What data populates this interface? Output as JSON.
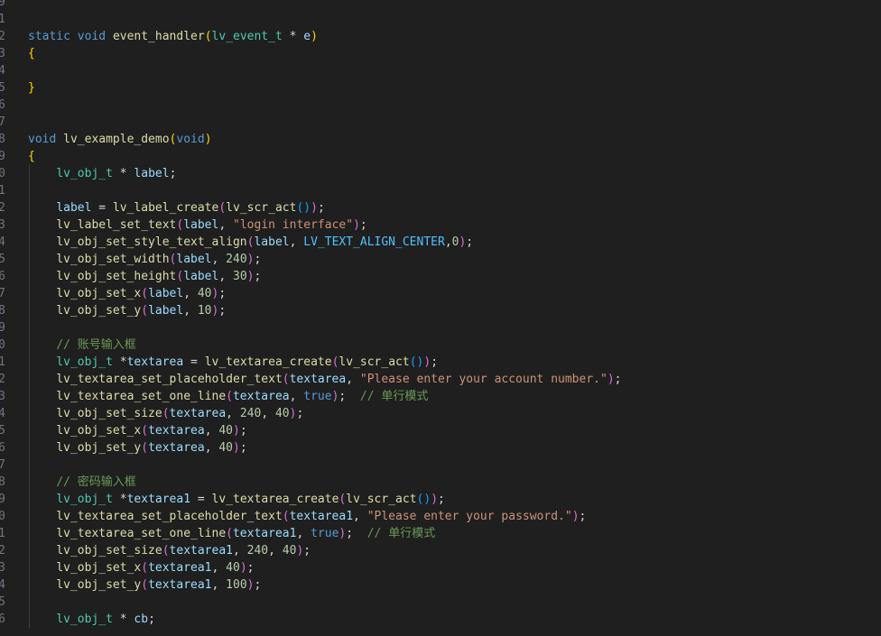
{
  "editor": {
    "lines": [
      {
        "n": "9",
        "t": []
      },
      {
        "n": "1",
        "t": []
      },
      {
        "n": "2",
        "t": [
          [
            "kw",
            "static"
          ],
          [
            "op",
            " "
          ],
          [
            "kw",
            "void"
          ],
          [
            "op",
            " "
          ],
          [
            "fn",
            "event_handler"
          ],
          [
            "p1",
            "("
          ],
          [
            "ty",
            "lv_event_t"
          ],
          [
            "op",
            " * "
          ],
          [
            "var",
            "e"
          ],
          [
            "p1",
            ")"
          ]
        ]
      },
      {
        "n": "3",
        "t": [
          [
            "p1",
            "{"
          ]
        ]
      },
      {
        "n": "4",
        "t": []
      },
      {
        "n": "5",
        "t": [
          [
            "p1",
            "}"
          ]
        ]
      },
      {
        "n": "6",
        "t": []
      },
      {
        "n": "7",
        "t": []
      },
      {
        "n": "8",
        "t": [
          [
            "kw",
            "void"
          ],
          [
            "op",
            " "
          ],
          [
            "fn",
            "lv_example_demo"
          ],
          [
            "p1",
            "("
          ],
          [
            "kw",
            "void"
          ],
          [
            "p1",
            ")"
          ]
        ]
      },
      {
        "n": "9",
        "t": [
          [
            "p1",
            "{"
          ]
        ]
      },
      {
        "n": "0",
        "t": [
          [
            "op",
            "    "
          ],
          [
            "ty",
            "lv_obj_t"
          ],
          [
            "op",
            " * "
          ],
          [
            "var",
            "label"
          ],
          [
            "op",
            ";"
          ]
        ]
      },
      {
        "n": "1",
        "t": []
      },
      {
        "n": "2",
        "t": [
          [
            "op",
            "    "
          ],
          [
            "var",
            "label"
          ],
          [
            "op",
            " = "
          ],
          [
            "fn",
            "lv_label_create"
          ],
          [
            "p2",
            "("
          ],
          [
            "fn",
            "lv_scr_act"
          ],
          [
            "p3",
            "()"
          ],
          [
            "p2",
            ")"
          ],
          [
            "op",
            ";"
          ]
        ]
      },
      {
        "n": "3",
        "t": [
          [
            "op",
            "    "
          ],
          [
            "fn",
            "lv_label_set_text"
          ],
          [
            "p2",
            "("
          ],
          [
            "var",
            "label"
          ],
          [
            "op",
            ", "
          ],
          [
            "str",
            "\"login interface\""
          ],
          [
            "p2",
            ")"
          ],
          [
            "op",
            ";"
          ]
        ]
      },
      {
        "n": "4",
        "t": [
          [
            "op",
            "    "
          ],
          [
            "fn",
            "lv_obj_set_style_text_align"
          ],
          [
            "p2",
            "("
          ],
          [
            "var",
            "label"
          ],
          [
            "op",
            ", "
          ],
          [
            "mac",
            "LV_TEXT_ALIGN_CENTER"
          ],
          [
            "op",
            ","
          ],
          [
            "num",
            "0"
          ],
          [
            "p2",
            ")"
          ],
          [
            "op",
            ";"
          ]
        ]
      },
      {
        "n": "5",
        "t": [
          [
            "op",
            "    "
          ],
          [
            "fn",
            "lv_obj_set_width"
          ],
          [
            "p2",
            "("
          ],
          [
            "var",
            "label"
          ],
          [
            "op",
            ", "
          ],
          [
            "num",
            "240"
          ],
          [
            "p2",
            ")"
          ],
          [
            "op",
            ";"
          ]
        ]
      },
      {
        "n": "6",
        "t": [
          [
            "op",
            "    "
          ],
          [
            "fn",
            "lv_obj_set_height"
          ],
          [
            "p2",
            "("
          ],
          [
            "var",
            "label"
          ],
          [
            "op",
            ", "
          ],
          [
            "num",
            "30"
          ],
          [
            "p2",
            ")"
          ],
          [
            "op",
            ";"
          ]
        ]
      },
      {
        "n": "7",
        "t": [
          [
            "op",
            "    "
          ],
          [
            "fn",
            "lv_obj_set_x"
          ],
          [
            "p2",
            "("
          ],
          [
            "var",
            "label"
          ],
          [
            "op",
            ", "
          ],
          [
            "num",
            "40"
          ],
          [
            "p2",
            ")"
          ],
          [
            "op",
            ";"
          ]
        ]
      },
      {
        "n": "8",
        "t": [
          [
            "op",
            "    "
          ],
          [
            "fn",
            "lv_obj_set_y"
          ],
          [
            "p2",
            "("
          ],
          [
            "var",
            "label"
          ],
          [
            "op",
            ", "
          ],
          [
            "num",
            "10"
          ],
          [
            "p2",
            ")"
          ],
          [
            "op",
            ";"
          ]
        ]
      },
      {
        "n": "9",
        "t": []
      },
      {
        "n": "0",
        "t": [
          [
            "op",
            "    "
          ],
          [
            "cmt",
            "// 账号输入框"
          ]
        ]
      },
      {
        "n": "1",
        "t": [
          [
            "op",
            "    "
          ],
          [
            "ty",
            "lv_obj_t"
          ],
          [
            "op",
            " *"
          ],
          [
            "var",
            "textarea"
          ],
          [
            "op",
            " = "
          ],
          [
            "fn",
            "lv_textarea_create"
          ],
          [
            "p2",
            "("
          ],
          [
            "fn",
            "lv_scr_act"
          ],
          [
            "p3",
            "()"
          ],
          [
            "p2",
            ")"
          ],
          [
            "op",
            ";"
          ]
        ]
      },
      {
        "n": "2",
        "t": [
          [
            "op",
            "    "
          ],
          [
            "fn",
            "lv_textarea_set_placeholder_text"
          ],
          [
            "p2",
            "("
          ],
          [
            "var",
            "textarea"
          ],
          [
            "op",
            ", "
          ],
          [
            "str",
            "\"Please enter your account number.\""
          ],
          [
            "p2",
            ")"
          ],
          [
            "op",
            ";"
          ]
        ]
      },
      {
        "n": "3",
        "t": [
          [
            "op",
            "    "
          ],
          [
            "fn",
            "lv_textarea_set_one_line"
          ],
          [
            "p2",
            "("
          ],
          [
            "var",
            "textarea"
          ],
          [
            "op",
            ", "
          ],
          [
            "kw",
            "true"
          ],
          [
            "p2",
            ")"
          ],
          [
            "op",
            ";  "
          ],
          [
            "cmt",
            "// 单行模式"
          ]
        ]
      },
      {
        "n": "4",
        "t": [
          [
            "op",
            "    "
          ],
          [
            "fn",
            "lv_obj_set_size"
          ],
          [
            "p2",
            "("
          ],
          [
            "var",
            "textarea"
          ],
          [
            "op",
            ", "
          ],
          [
            "num",
            "240"
          ],
          [
            "op",
            ", "
          ],
          [
            "num",
            "40"
          ],
          [
            "p2",
            ")"
          ],
          [
            "op",
            ";"
          ]
        ]
      },
      {
        "n": "5",
        "t": [
          [
            "op",
            "    "
          ],
          [
            "fn",
            "lv_obj_set_x"
          ],
          [
            "p2",
            "("
          ],
          [
            "var",
            "textarea"
          ],
          [
            "op",
            ", "
          ],
          [
            "num",
            "40"
          ],
          [
            "p2",
            ")"
          ],
          [
            "op",
            ";"
          ]
        ]
      },
      {
        "n": "6",
        "t": [
          [
            "op",
            "    "
          ],
          [
            "fn",
            "lv_obj_set_y"
          ],
          [
            "p2",
            "("
          ],
          [
            "var",
            "textarea"
          ],
          [
            "op",
            ", "
          ],
          [
            "num",
            "40"
          ],
          [
            "p2",
            ")"
          ],
          [
            "op",
            ";"
          ]
        ]
      },
      {
        "n": "7",
        "t": []
      },
      {
        "n": "8",
        "t": [
          [
            "op",
            "    "
          ],
          [
            "cmt",
            "// 密码输入框"
          ]
        ]
      },
      {
        "n": "9",
        "t": [
          [
            "op",
            "    "
          ],
          [
            "ty",
            "lv_obj_t"
          ],
          [
            "op",
            " *"
          ],
          [
            "var",
            "textarea1"
          ],
          [
            "op",
            " = "
          ],
          [
            "fn",
            "lv_textarea_create"
          ],
          [
            "p2",
            "("
          ],
          [
            "fn",
            "lv_scr_act"
          ],
          [
            "p3",
            "()"
          ],
          [
            "p2",
            ")"
          ],
          [
            "op",
            ";"
          ]
        ]
      },
      {
        "n": "0",
        "t": [
          [
            "op",
            "    "
          ],
          [
            "fn",
            "lv_textarea_set_placeholder_text"
          ],
          [
            "p2",
            "("
          ],
          [
            "var",
            "textarea1"
          ],
          [
            "op",
            ", "
          ],
          [
            "str",
            "\"Please enter your password.\""
          ],
          [
            "p2",
            ")"
          ],
          [
            "op",
            ";"
          ]
        ]
      },
      {
        "n": "1",
        "t": [
          [
            "op",
            "    "
          ],
          [
            "fn",
            "lv_textarea_set_one_line"
          ],
          [
            "p2",
            "("
          ],
          [
            "var",
            "textarea1"
          ],
          [
            "op",
            ", "
          ],
          [
            "kw",
            "true"
          ],
          [
            "p2",
            ")"
          ],
          [
            "op",
            ";  "
          ],
          [
            "cmt",
            "// 单行模式"
          ]
        ]
      },
      {
        "n": "2",
        "t": [
          [
            "op",
            "    "
          ],
          [
            "fn",
            "lv_obj_set_size"
          ],
          [
            "p2",
            "("
          ],
          [
            "var",
            "textarea1"
          ],
          [
            "op",
            ", "
          ],
          [
            "num",
            "240"
          ],
          [
            "op",
            ", "
          ],
          [
            "num",
            "40"
          ],
          [
            "p2",
            ")"
          ],
          [
            "op",
            ";"
          ]
        ]
      },
      {
        "n": "3",
        "t": [
          [
            "op",
            "    "
          ],
          [
            "fn",
            "lv_obj_set_x"
          ],
          [
            "p2",
            "("
          ],
          [
            "var",
            "textarea1"
          ],
          [
            "op",
            ", "
          ],
          [
            "num",
            "40"
          ],
          [
            "p2",
            ")"
          ],
          [
            "op",
            ";"
          ]
        ]
      },
      {
        "n": "4",
        "t": [
          [
            "op",
            "    "
          ],
          [
            "fn",
            "lv_obj_set_y"
          ],
          [
            "p2",
            "("
          ],
          [
            "var",
            "textarea1"
          ],
          [
            "op",
            ", "
          ],
          [
            "num",
            "100"
          ],
          [
            "p2",
            ")"
          ],
          [
            "op",
            ";"
          ]
        ]
      },
      {
        "n": "5",
        "t": []
      },
      {
        "n": "6",
        "t": [
          [
            "op",
            "    "
          ],
          [
            "ty",
            "lv_obj_t"
          ],
          [
            "op",
            " * "
          ],
          [
            "var",
            "cb"
          ],
          [
            "op",
            ";"
          ]
        ]
      }
    ]
  }
}
